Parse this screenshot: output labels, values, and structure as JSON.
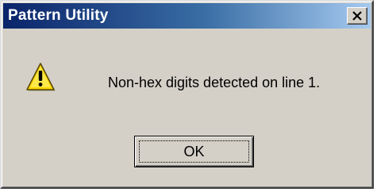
{
  "window": {
    "title": "Pattern Utility",
    "close_icon": "close-icon"
  },
  "dialog": {
    "icon": "warning-icon",
    "message": "Non-hex digits detected on line 1."
  },
  "buttons": {
    "ok_label": "OK"
  },
  "colors": {
    "titlebar_start": "#0a246a",
    "titlebar_end": "#a6caf0",
    "face": "#d4d0c8",
    "warning_yellow": "#ffd700"
  }
}
